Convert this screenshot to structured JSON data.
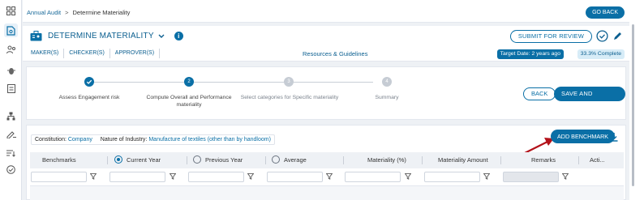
{
  "breadcrumb": {
    "root": "Annual Audit",
    "separator": ">",
    "current": "Determine Materiality"
  },
  "go_back_label": "GO BACK",
  "header": {
    "title": "DETERMINE MATERIALITY",
    "info_glyph": "i",
    "submit_label": "SUBMIT FOR REVIEW",
    "tabs": [
      "MAKER(S)",
      "CHECKER(S)",
      "APPROVER(S)"
    ],
    "resources_label": "Resources & Guidelines",
    "target_date": "Target Date: 2 years ago",
    "completion": "33.3% Complete"
  },
  "stepper": {
    "steps": [
      {
        "label": "Assess Engagement risk",
        "state": "done",
        "marker": ""
      },
      {
        "label": "Compute Overall and Performance materiality",
        "state": "current",
        "marker": "2"
      },
      {
        "label": "Select categories for Specific materiality",
        "state": "todo",
        "marker": "3"
      },
      {
        "label": "Summary",
        "state": "todo",
        "marker": "4"
      }
    ],
    "back_label": "BACK",
    "save_label": "SAVE AND PROCEED"
  },
  "filters_info": {
    "constitution_label": "Constitution:",
    "constitution_value": "Company",
    "industry_label": "Nature of Industry:",
    "industry_value": "Manufacture of textiles (other than by handloom)"
  },
  "add_benchmark_label": "ADD BENCHMARK",
  "table": {
    "columns": {
      "benchmarks": "Benchmarks",
      "current_year": "Current Year",
      "previous_year": "Previous Year",
      "average": "Average",
      "materiality_pct": "Materiality (%)",
      "materiality_amount": "Materiality Amount",
      "remarks": "Remarks",
      "actions": "Acti..."
    },
    "selected_basis": "Current Year"
  },
  "colors": {
    "accent": "#0a6fa6",
    "annotation_arrow": "#b3121a"
  },
  "icons": {
    "rail": [
      "grid-icon",
      "document-icon",
      "users-icon",
      "bug-icon",
      "list-icon",
      "org-chart-icon",
      "pencil-plus-icon",
      "sort-icon",
      "check-circle-icon"
    ],
    "header": [
      "briefcase-icon",
      "chevron-down-icon",
      "info-icon",
      "check-circle-icon",
      "edit-icon"
    ],
    "table": [
      "funnel-icon",
      "download-icon"
    ]
  }
}
